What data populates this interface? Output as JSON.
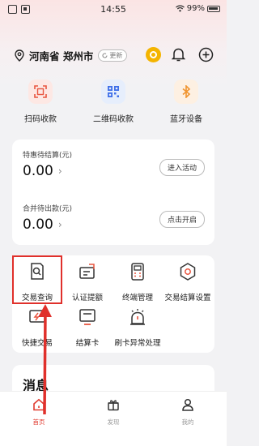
{
  "status_bar": {
    "time": "14:55",
    "battery": "99%"
  },
  "location": {
    "text": "河南省 郑州市",
    "update_label": "更新"
  },
  "quick_actions": [
    {
      "label": "扫码收款",
      "icon": "scan-pay-icon",
      "bg": "#fde8e4",
      "fg": "#e8553f"
    },
    {
      "label": "二维码收款",
      "icon": "qrcode-icon",
      "bg": "#e6eefc",
      "fg": "#3f6fe8"
    },
    {
      "label": "蓝牙设备",
      "icon": "bluetooth-icon",
      "bg": "#fdf0e2",
      "fg": "#f0942e"
    }
  ],
  "balance": {
    "pending_label": "特惠待结算(元)",
    "pending_amount": "0.00",
    "pending_action": "进入活动",
    "combined_label": "合并待出款(元)",
    "combined_amount": "0.00",
    "combined_action": "点击开启"
  },
  "functions": [
    {
      "label": "交易查询",
      "icon": "transaction-query-icon"
    },
    {
      "label": "认证提额",
      "icon": "auth-limit-icon"
    },
    {
      "label": "终端管理",
      "icon": "terminal-manage-icon"
    },
    {
      "label": "交易结算设置",
      "icon": "settlement-settings-icon"
    },
    {
      "label": "快捷交易",
      "icon": "quick-trade-icon"
    },
    {
      "label": "结算卡",
      "icon": "settlement-card-icon"
    },
    {
      "label": "刷卡异常处理",
      "icon": "card-exception-icon"
    }
  ],
  "messages": {
    "title": "消息"
  },
  "bottom_nav": [
    {
      "label": "首页",
      "icon": "home-icon"
    },
    {
      "label": "发现",
      "icon": "discover-icon"
    },
    {
      "label": "我的",
      "icon": "profile-icon"
    }
  ],
  "colors": {
    "accent": "#e03a2f",
    "highlight": "#e0302b"
  }
}
